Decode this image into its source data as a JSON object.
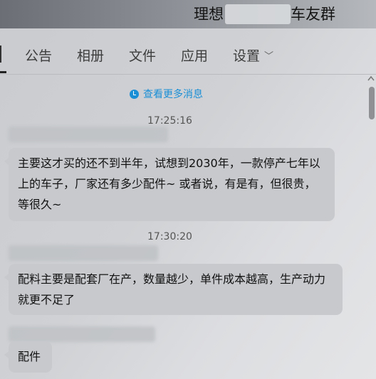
{
  "window": {
    "title_left": "理想",
    "title_right": "车友群"
  },
  "tabs": {
    "first_partial": "",
    "items": [
      "公告",
      "相册",
      "文件",
      "应用",
      "设置"
    ]
  },
  "more_link": "查看更多消息",
  "messages": [
    {
      "time": "17:25:16",
      "text": "主要这才买的还不到半年，试想到2030年，一款停产七年以上的车子，厂家还有多少配件~  或者说，有是有，但很贵，等很久~"
    },
    {
      "time": "17:30:20",
      "text": "配料主要是配套厂在产，数量越少，单件成本越高，生产动力就更不足了"
    },
    {
      "time": "",
      "text": "配件"
    }
  ],
  "icons": {
    "more": "clock-icon",
    "settings_dropdown": "chevron-down-icon",
    "scroll": "scroll-up-icon"
  },
  "colors": {
    "accent": "#1a8fd6",
    "bubble": "#c7c9cd"
  }
}
